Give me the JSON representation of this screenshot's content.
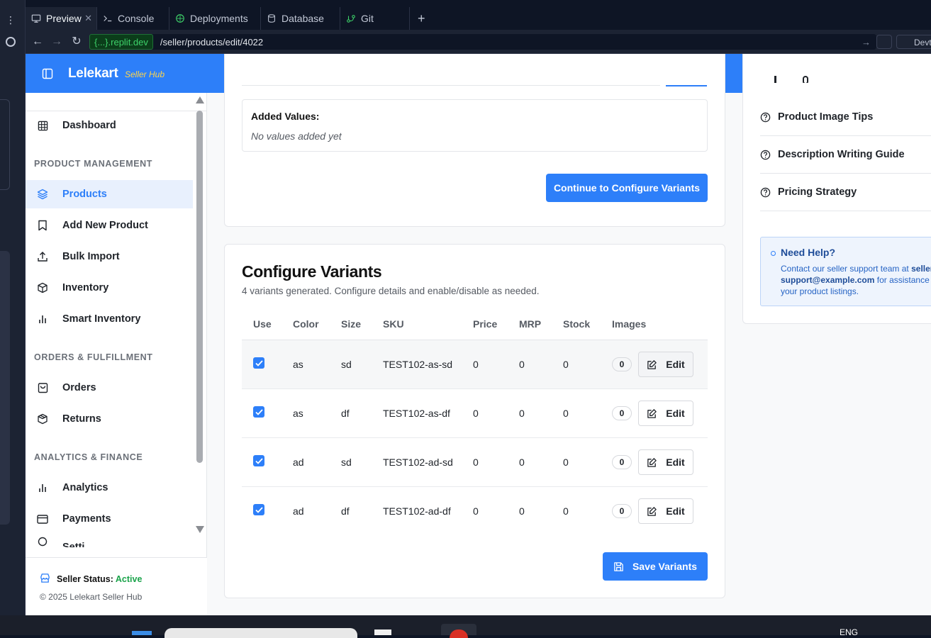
{
  "ide": {
    "tabs": [
      {
        "label": "Preview",
        "icon": "monitor-icon",
        "active": true
      },
      {
        "label": "Console",
        "icon": "terminal-icon"
      },
      {
        "label": "Deployments",
        "icon": "deploy-icon"
      },
      {
        "label": "Database",
        "icon": "database-icon"
      },
      {
        "label": "Git",
        "icon": "git-icon"
      }
    ],
    "url_host": "{...}.replit.dev",
    "url_path": "/seller/products/edit/4022",
    "devtools_label": "Devt"
  },
  "app": {
    "brand": "Lelekart",
    "brand_sub": "Seller Hub",
    "sidebar": {
      "dashboard": "Dashboard",
      "sections": {
        "product": "PRODUCT MANAGEMENT",
        "orders": "ORDERS & FULFILLMENT",
        "analytics": "ANALYTICS & FINANCE"
      },
      "items": {
        "products": "Products",
        "add_new": "Add New Product",
        "bulk_import": "Bulk Import",
        "inventory": "Inventory",
        "smart_inventory": "Smart Inventory",
        "orders": "Orders",
        "returns": "Returns",
        "analytics": "Analytics",
        "payments": "Payments",
        "settings_partial": "Setti"
      },
      "footer": {
        "status_label": "Seller Status:",
        "status_value": "Active",
        "copyright": "© 2025 Lelekart Seller Hub"
      }
    },
    "values_card": {
      "added_values_label": "Added Values:",
      "empty_text": "No values added yet",
      "continue_button": "Continue to Configure Variants"
    },
    "variants": {
      "title": "Configure Variants",
      "subtitle": "4 variants generated. Configure details and enable/disable as needed.",
      "columns": [
        "Use",
        "Color",
        "Size",
        "SKU",
        "Price",
        "MRP",
        "Stock",
        "Images"
      ],
      "rows": [
        {
          "color": "as",
          "size": "sd",
          "sku": "TEST102-as-sd",
          "price": "0",
          "mrp": "0",
          "stock": "0",
          "images": "0",
          "enabled": true
        },
        {
          "color": "as",
          "size": "df",
          "sku": "TEST102-as-df",
          "price": "0",
          "mrp": "0",
          "stock": "0",
          "images": "0",
          "enabled": true
        },
        {
          "color": "ad",
          "size": "sd",
          "sku": "TEST102-ad-sd",
          "price": "0",
          "mrp": "0",
          "stock": "0",
          "images": "0",
          "enabled": true
        },
        {
          "color": "ad",
          "size": "df",
          "sku": "TEST102-ad-df",
          "price": "0",
          "mrp": "0",
          "stock": "0",
          "images": "0",
          "enabled": true
        }
      ],
      "edit_label": "Edit",
      "save_button": "Save Variants"
    },
    "tips": {
      "items": [
        "Product Image Tips",
        "Description Writing Guide",
        "Pricing Strategy"
      ],
      "help_title": "Need Help?",
      "help_text_1": "Contact our seller support team at ",
      "help_email_1": "seller",
      "help_email_2": "support@example.com",
      "help_text_2": " for assistance w",
      "help_text_3": "your product listings."
    }
  },
  "taskbar": {
    "lang": "ENG"
  },
  "colors": {
    "accent": "#2d7ff9",
    "active_status": "#1aa34a",
    "brand_sub": "#ffd54a"
  }
}
